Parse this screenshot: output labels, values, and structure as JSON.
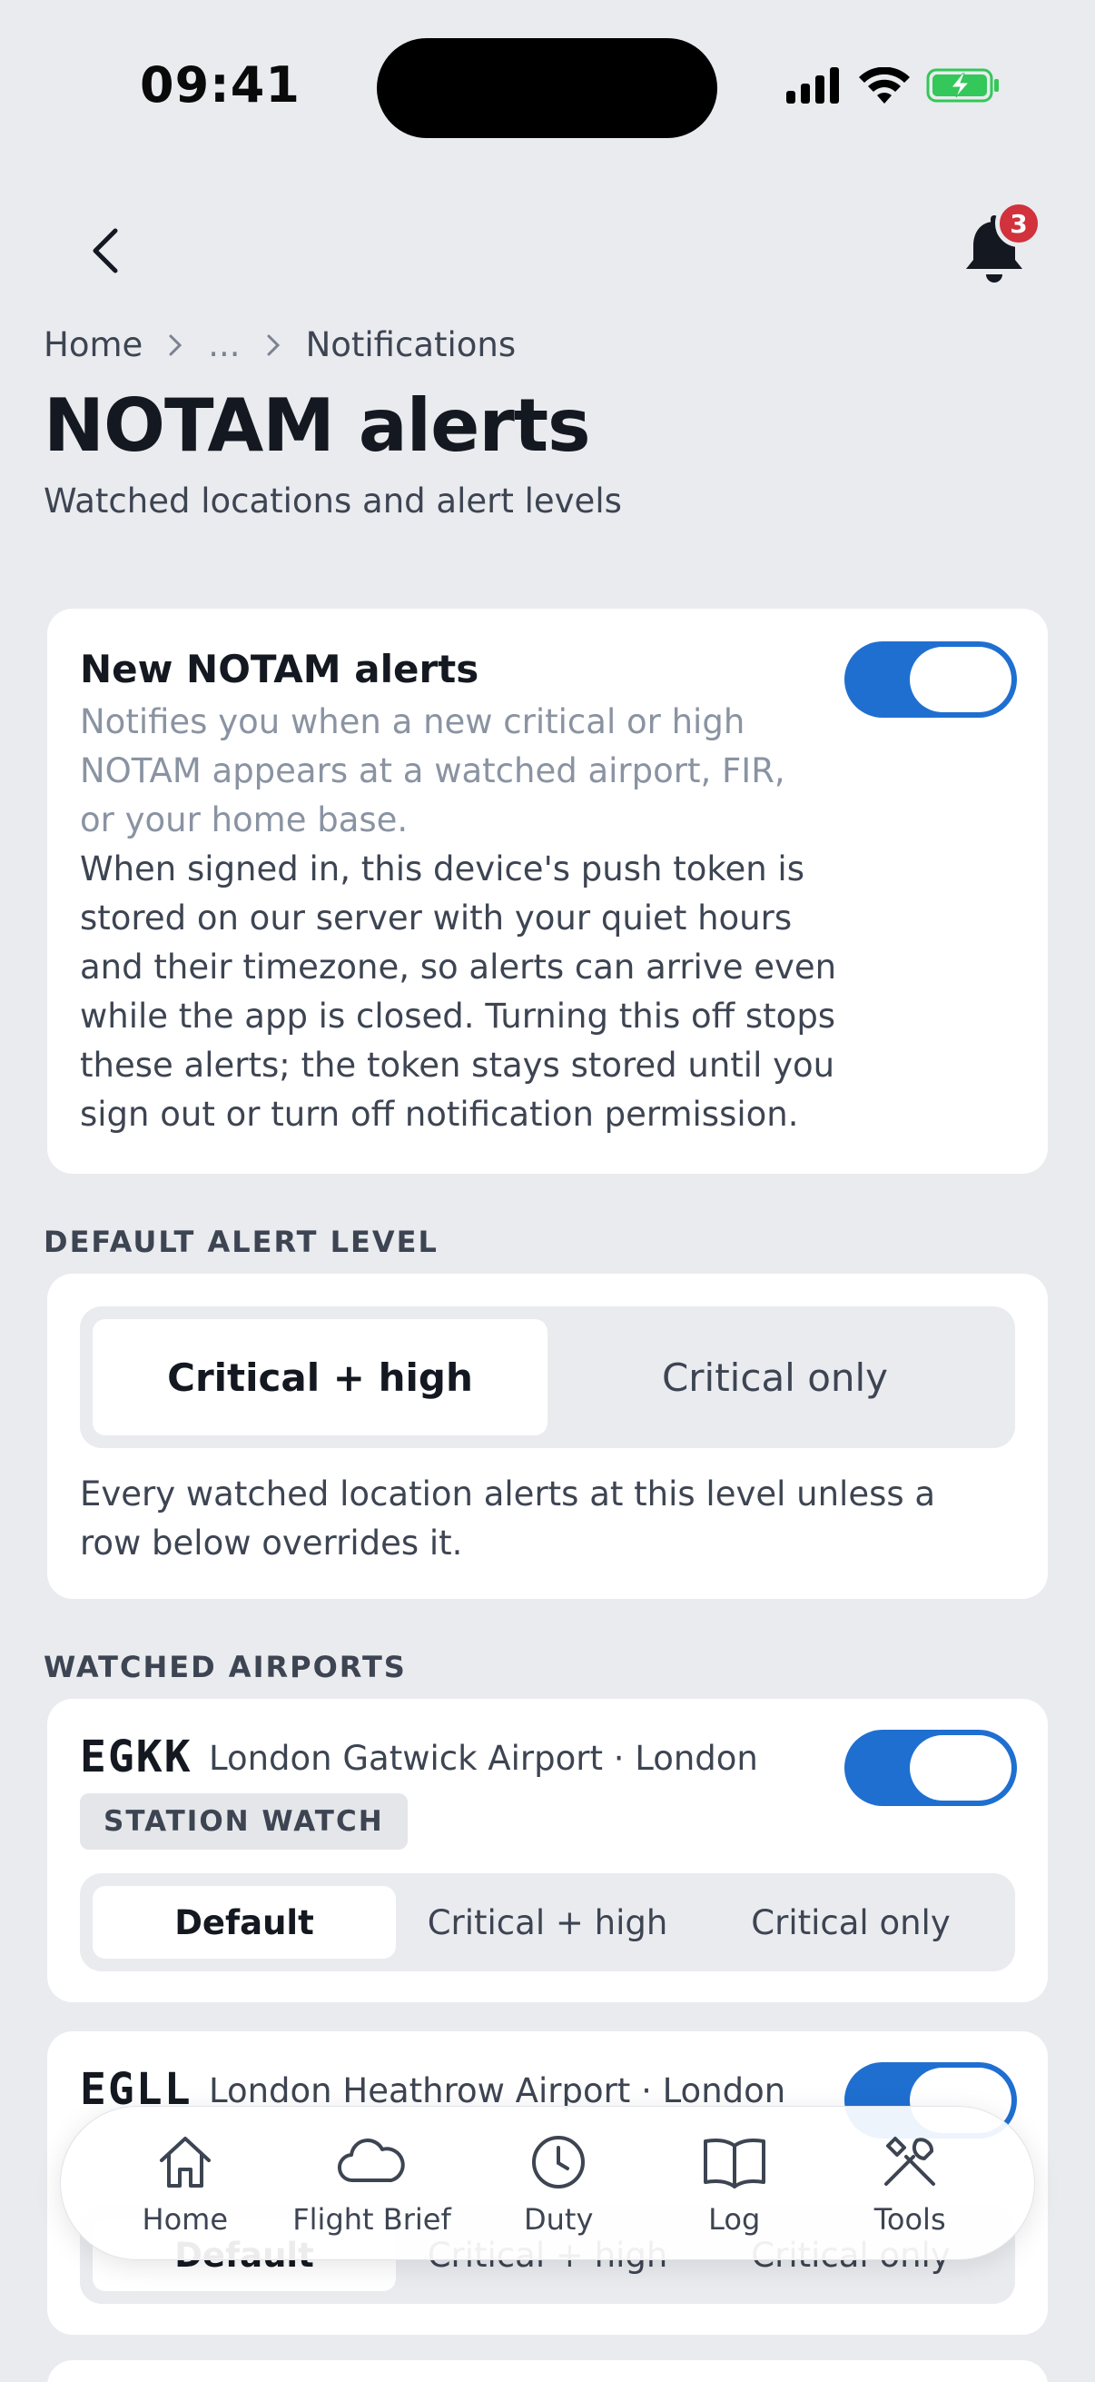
{
  "status_bar": {
    "time": "09:41"
  },
  "notifications": {
    "badge_count": "3"
  },
  "breadcrumb": {
    "items": [
      "Home",
      "...",
      "Notifications"
    ]
  },
  "page": {
    "title": "NOTAM alerts",
    "subtitle": "Watched locations and alert levels"
  },
  "new_alerts": {
    "title": "New NOTAM alerts",
    "hint": "Notifies you when a new critical or high NOTAM appears at a watched airport, FIR, or your home base.",
    "body": "When signed in, this device's push token is stored on our server with your quiet hours and their timezone, so alerts can arrive even while the app is closed. Turning this off stops these alerts; the token stays stored until you sign out or turn off notification permission.",
    "enabled": true
  },
  "default_level": {
    "section_label": "DEFAULT ALERT LEVEL",
    "options": [
      "Critical + high",
      "Critical only"
    ],
    "selected": "Critical + high",
    "description": "Every watched location alerts at this level unless a row below overrides it."
  },
  "watched_airports": {
    "section_label": "WATCHED AIRPORTS",
    "level_options": [
      "Default",
      "Critical + high",
      "Critical only"
    ],
    "items": [
      {
        "icao": "EGKK",
        "name": "London Gatwick Airport · London",
        "chip": "STATION WATCH",
        "enabled": true,
        "selected": "Default"
      },
      {
        "icao": "EGLL",
        "name": "London Heathrow Airport · London",
        "enabled": true,
        "selected": "Default"
      }
    ]
  },
  "tab_bar": {
    "tabs": [
      {
        "label": "Home",
        "icon": "home-icon"
      },
      {
        "label": "Flight Brief",
        "icon": "cloud-icon"
      },
      {
        "label": "Duty",
        "icon": "clock-icon"
      },
      {
        "label": "Log",
        "icon": "book-icon"
      },
      {
        "label": "Tools",
        "icon": "tools-icon"
      }
    ]
  },
  "colors": {
    "accent": "#1f6fd1",
    "badge": "#d1323c",
    "background": "#e9ebef"
  }
}
